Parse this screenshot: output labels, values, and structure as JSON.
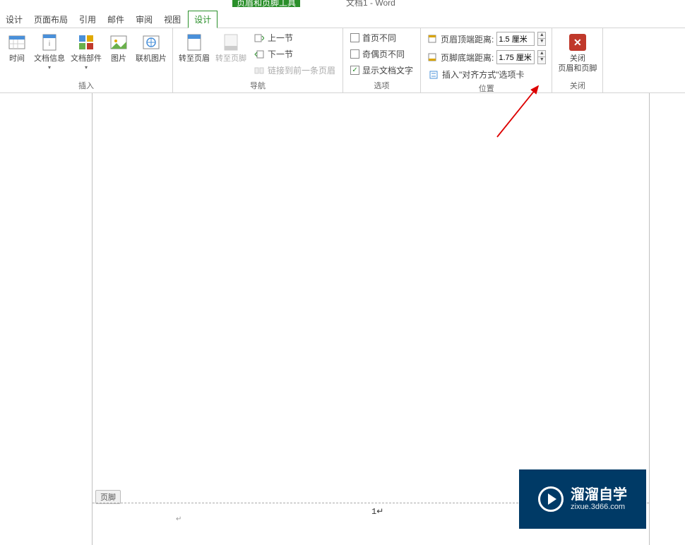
{
  "title": {
    "contextual_tool": "页眉和页脚工具",
    "document": "文档1 - Word"
  },
  "tabs": {
    "design_main": "设计",
    "page_layout": "页面布局",
    "references": "引用",
    "mailings": "邮件",
    "review": "审阅",
    "view": "视图",
    "design_context": "设计"
  },
  "ribbon": {
    "insert_group": {
      "label": "插入",
      "datetime": "时间",
      "doc_info": "文档信息",
      "doc_parts": "文档部件",
      "picture": "图片",
      "online_picture": "联机图片"
    },
    "nav_group": {
      "label": "导航",
      "goto_header": "转至页眉",
      "goto_footer": "转至页脚",
      "prev_section": "上一节",
      "next_section": "下一节",
      "link_previous": "链接到前一条页眉"
    },
    "options_group": {
      "label": "选项",
      "diff_first": "首页不同",
      "diff_odd_even": "奇偶页不同",
      "show_doc_text": "显示文档文字"
    },
    "position_group": {
      "label": "位置",
      "header_top": "页眉顶端距离:",
      "header_top_value": "1.5 厘米",
      "footer_bottom": "页脚底端距离:",
      "footer_bottom_value": "1.75 厘米",
      "insert_align_tab": "插入\"对齐方式\"选项卡"
    },
    "close_group": {
      "label": "关闭",
      "close_line1": "关闭",
      "close_line2": "页眉和页脚"
    }
  },
  "page": {
    "footer_tag": "页脚",
    "page_number": "1",
    "para_mark": "↵"
  },
  "watermark": {
    "cn": "溜溜自学",
    "en": "zixue.3d66.com"
  }
}
